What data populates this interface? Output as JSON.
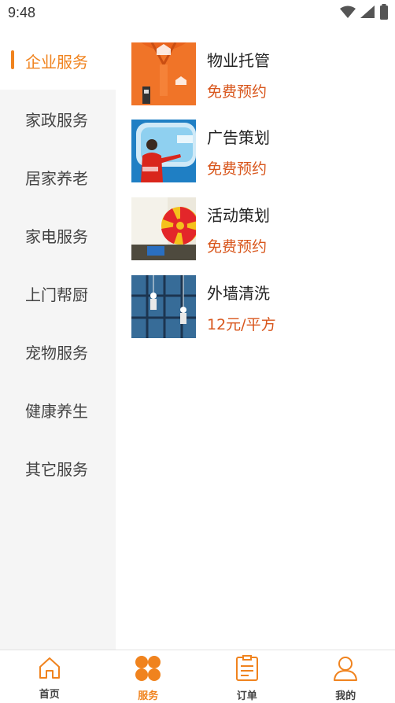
{
  "status": {
    "time": "9:48",
    "icons": [
      "wifi-icon",
      "signal-icon",
      "battery-icon"
    ]
  },
  "colors": {
    "accent": "#f0831e",
    "price": "#d8561c",
    "sidebar_bg": "#f5f5f5"
  },
  "sidebar": {
    "items": [
      {
        "label": "企业服务",
        "active": true
      },
      {
        "label": "家政服务",
        "active": false
      },
      {
        "label": "居家养老",
        "active": false
      },
      {
        "label": "家电服务",
        "active": false
      },
      {
        "label": "上门帮厨",
        "active": false
      },
      {
        "label": "宠物服务",
        "active": false
      },
      {
        "label": "健康养生",
        "active": false
      },
      {
        "label": "其它服务",
        "active": false
      }
    ]
  },
  "services": [
    {
      "name": "物业托管",
      "price": "免费预约",
      "image": "orange-uniform-photo"
    },
    {
      "name": "广告策划",
      "price": "免费预约",
      "image": "presenter-screen-photo"
    },
    {
      "name": "活动策划",
      "price": "免费预约",
      "image": "prize-wheel-photo"
    },
    {
      "name": "外墙清洗",
      "price": "12元/平方",
      "image": "window-cleaners-photo"
    }
  ],
  "tabbar": {
    "tabs": [
      {
        "label": "首页",
        "icon": "home-icon",
        "active": false
      },
      {
        "label": "服务",
        "icon": "grid-icon",
        "active": true
      },
      {
        "label": "订单",
        "icon": "clipboard-icon",
        "active": false
      },
      {
        "label": "我的",
        "icon": "user-icon",
        "active": false
      }
    ]
  }
}
